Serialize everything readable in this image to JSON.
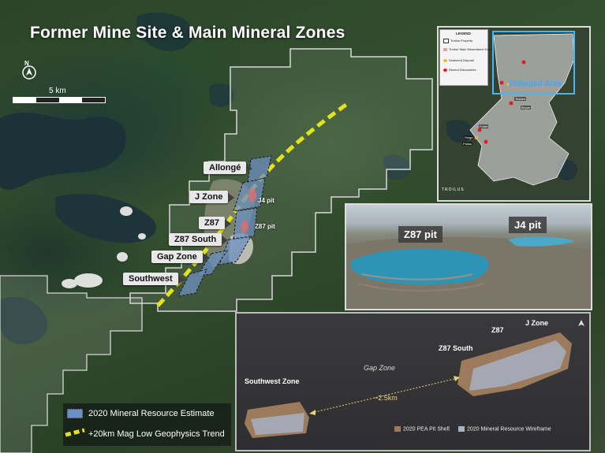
{
  "title": "Former Mine Site & Main Mineral Zones",
  "north_label": "N",
  "scale": {
    "label": "5 km"
  },
  "zones": [
    {
      "name": "Allongé"
    },
    {
      "name": "J Zone"
    },
    {
      "name": "Z87"
    },
    {
      "name": "Z87 South"
    },
    {
      "name": "Gap Zone"
    },
    {
      "name": "Southwest"
    }
  ],
  "pits": {
    "j4": "J4 pit",
    "z87": "Z87 pit"
  },
  "legend": {
    "items": [
      {
        "label": "2020 Mineral Resource Estimate",
        "color": "#6c8fbf"
      },
      {
        "label": "+20km Mag Low Geophysics Trend",
        "color": "#e3e31a"
      }
    ]
  },
  "inset_map": {
    "legend_title": "LEGEND",
    "legend_items": [
      {
        "label": "Troilus Property",
        "color": "#ffffff"
      },
      {
        "label": "Troilus' Main Mineralized Zones",
        "color": "#f3a0a0"
      },
      {
        "label": "Sediment Deposit",
        "color": "#f0b04a"
      },
      {
        "label": "Recent Discoveries",
        "color": "#e02020"
      }
    ],
    "enlarged_label": "Enlarged Area",
    "brand": "TROILUS",
    "place_labels": [
      "Testard",
      "Beyan",
      "Frotet",
      "Hinge",
      "Pallas"
    ]
  },
  "photo": {
    "left_label": "Z87 pit",
    "right_label": "J4 pit"
  },
  "section": {
    "labels": {
      "southwest": "Southwest Zone",
      "z87_south": "Z87 South",
      "z87": "Z87",
      "j_zone": "J Zone"
    },
    "gap_label": "Gap Zone",
    "distance_label": "~2.5km",
    "legend": [
      {
        "label": "2020 PEA Pit Shell",
        "color": "#9c7a5c"
      },
      {
        "label": "2020 Mineral Resource Wireframe",
        "color": "#a8b4c8"
      }
    ]
  },
  "colors": {
    "trend": "#e3e31a",
    "property_outline": "#d8d8d8",
    "resource": "#6c8fbf",
    "enlarged": "#47b4ff"
  }
}
